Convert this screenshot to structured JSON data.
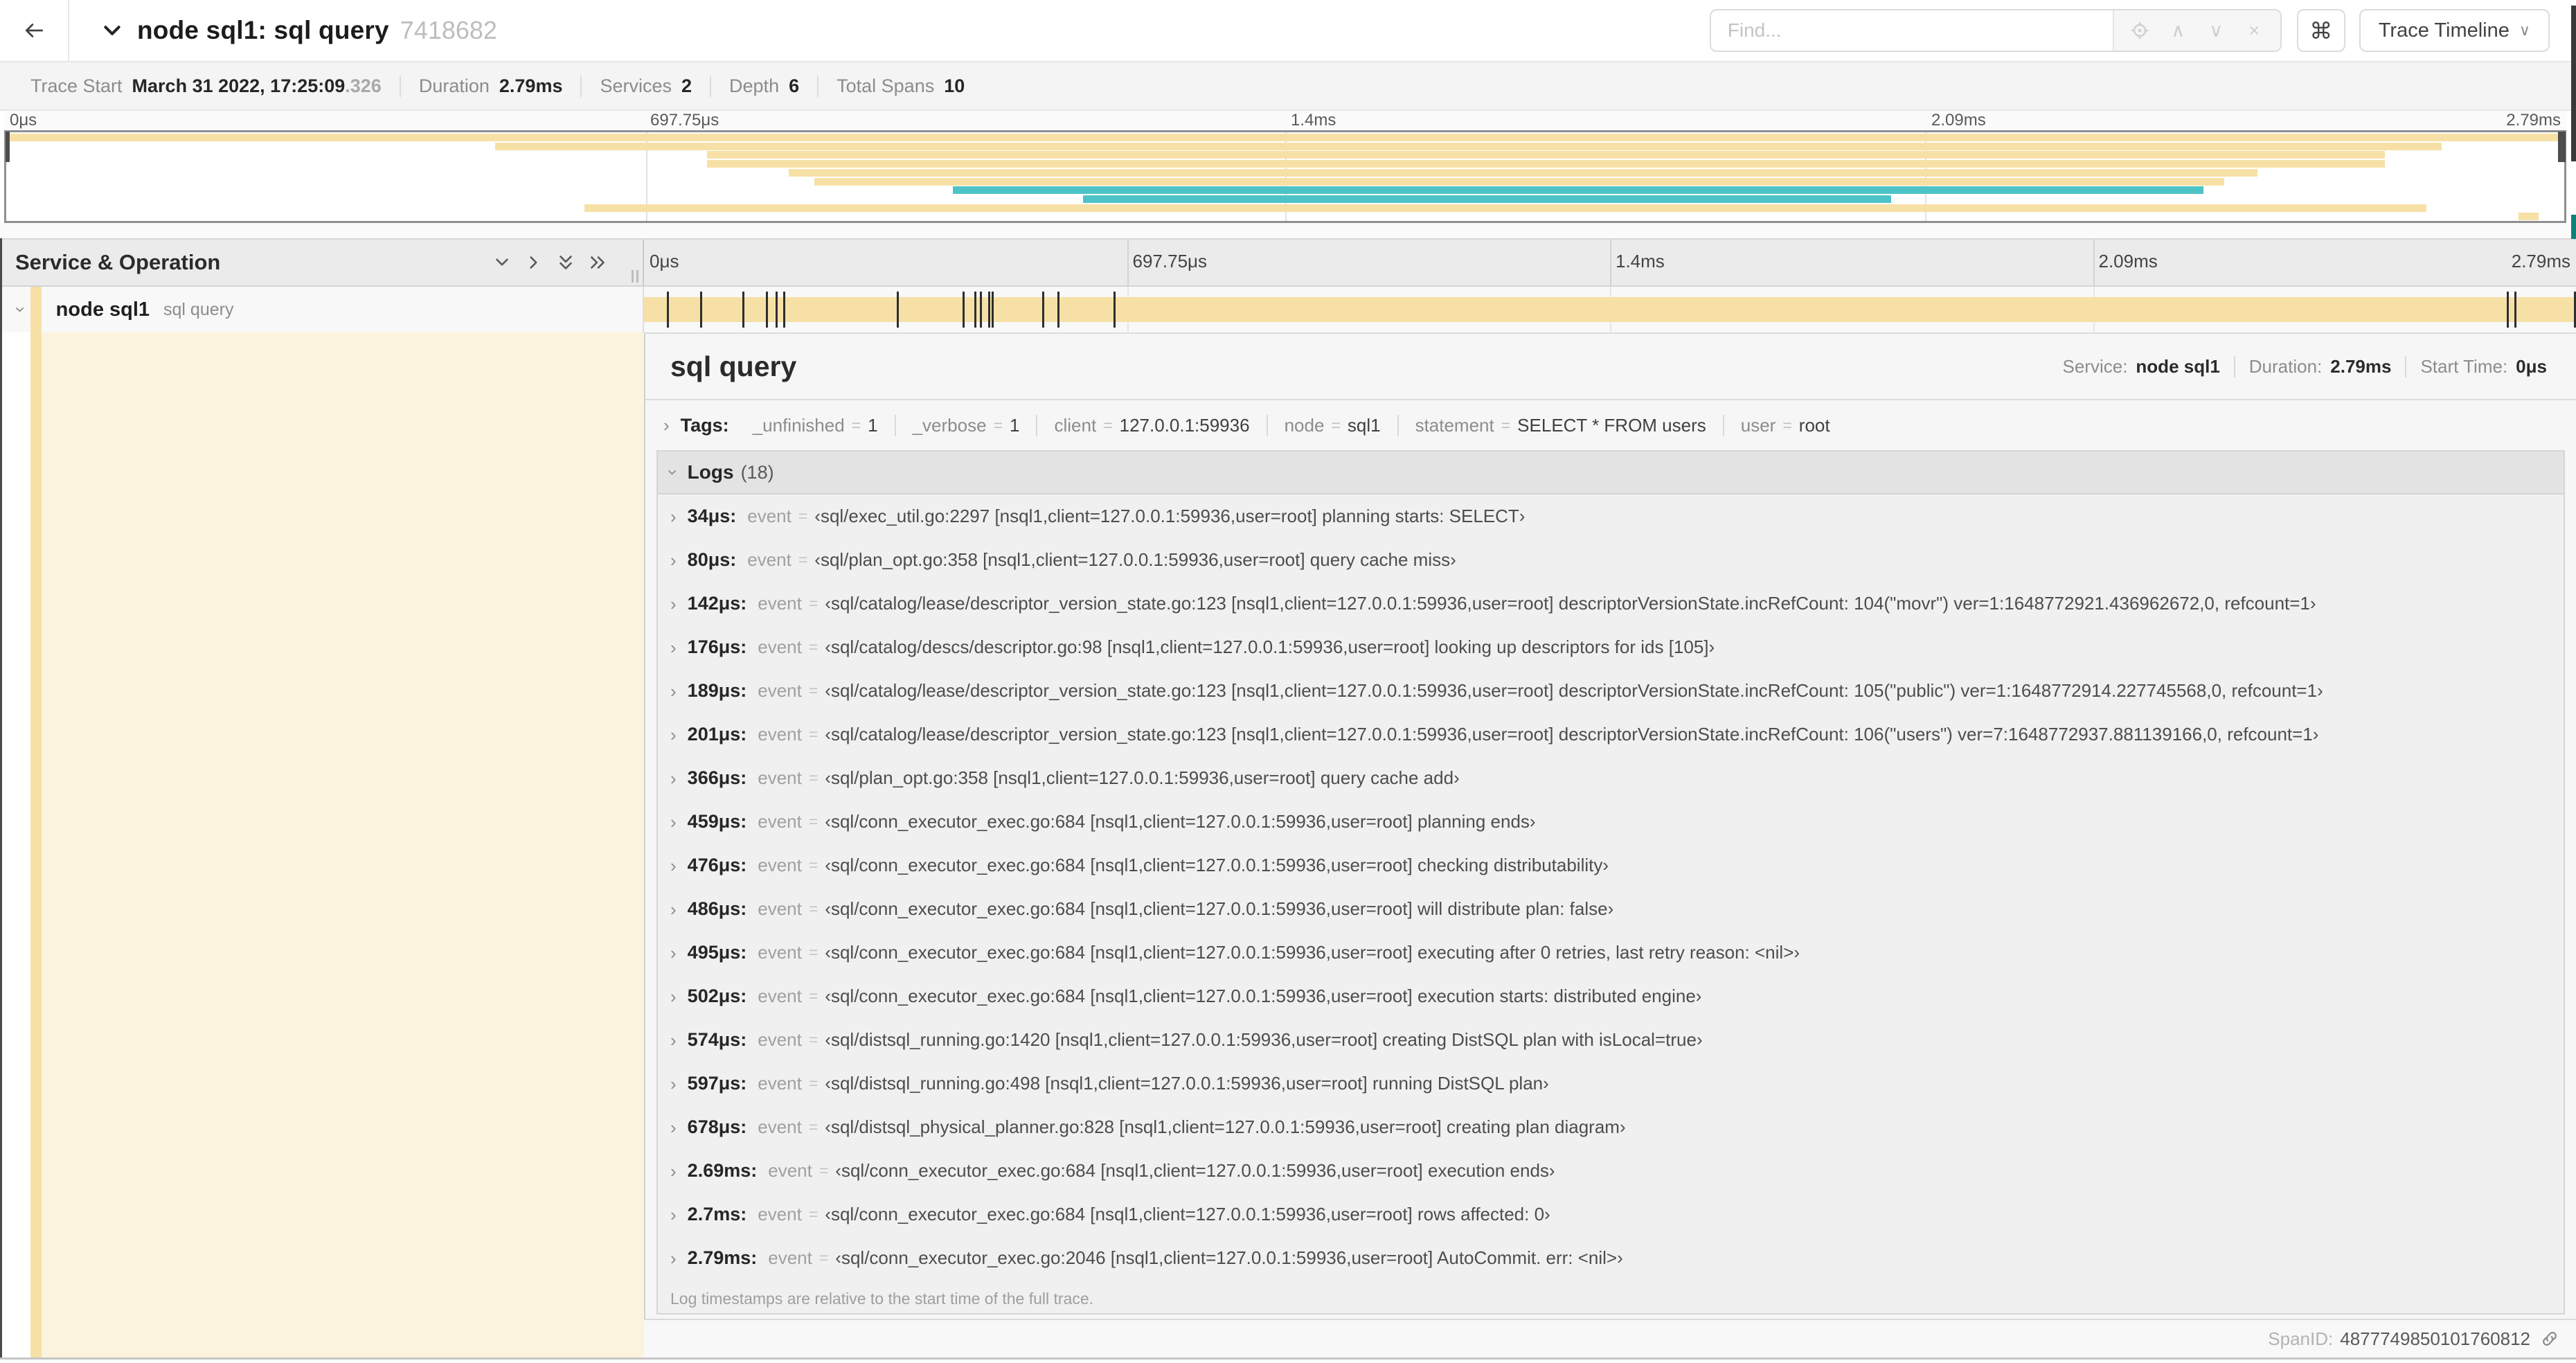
{
  "colors": {
    "yellow": "#F6E0A5",
    "teal": "#4EC3C7",
    "cream": "#FBF3DE",
    "scrubber": "#4D4D4D",
    "marker": "#2E2E2E"
  },
  "header": {
    "title": "node sql1: sql query",
    "trace_id_short": "7418682",
    "find_placeholder": "Find...",
    "prev_icon": "∧",
    "next_icon": "∨",
    "clear_icon": "×",
    "shortcut_icon": "⌘",
    "view_dropdown_label": "Trace Timeline",
    "view_dropdown_chevron": "∨"
  },
  "trace_info": {
    "items": [
      {
        "label": "Trace Start",
        "value": "March 31 2022, 17:25:09",
        "suffix": ".326"
      },
      {
        "label": "Duration",
        "value": "2.79ms"
      },
      {
        "label": "Services",
        "value": "2"
      },
      {
        "label": "Depth",
        "value": "6"
      },
      {
        "label": "Total Spans",
        "value": "10"
      }
    ]
  },
  "ruler": {
    "ticks": [
      {
        "label": "0μs",
        "pct": 0
      },
      {
        "label": "697.75μs",
        "pct": 25
      },
      {
        "label": "1.4ms",
        "pct": 50
      },
      {
        "label": "2.09ms",
        "pct": 75
      },
      {
        "label": "2.79ms",
        "pct": 100
      }
    ]
  },
  "minimap": {
    "rows": [
      {
        "start": 0,
        "end": 100,
        "color": "yellow"
      },
      {
        "start": 19.1,
        "end": 95.2,
        "color": "yellow"
      },
      {
        "start": 27.4,
        "end": 93.0,
        "color": "yellow"
      },
      {
        "start": 27.4,
        "end": 93.0,
        "color": "yellow"
      },
      {
        "start": 30.6,
        "end": 88.0,
        "color": "yellow"
      },
      {
        "start": 31.6,
        "end": 86.7,
        "color": "yellow"
      },
      {
        "start": 37.0,
        "end": 85.9,
        "color": "teal"
      },
      {
        "start": 42.1,
        "end": 73.7,
        "color": "teal"
      },
      {
        "start": 22.6,
        "end": 94.6,
        "color": "yellow"
      },
      {
        "start": 98.2,
        "end": 99.0,
        "color": "yellow"
      }
    ]
  },
  "timeline": {
    "left_header": "Service & Operation",
    "span_row": {
      "service": "node sql1",
      "operation": "sql query",
      "bar": {
        "start": 0,
        "end": 100,
        "color": "yellow"
      }
    },
    "log_marker_pcts": [
      1.2,
      2.9,
      5.1,
      6.3,
      6.8,
      7.2,
      13.1,
      16.5,
      17.1,
      17.4,
      17.8,
      18.0,
      20.6,
      21.4,
      24.3,
      96.4,
      96.8,
      99.9
    ]
  },
  "detail": {
    "operation": "sql query",
    "meta": [
      {
        "label": "Service:",
        "value": "node sql1"
      },
      {
        "label": "Duration:",
        "value": "2.79ms"
      },
      {
        "label": "Start Time:",
        "value": "0μs"
      }
    ],
    "tags_label": "Tags:",
    "tags_eq": "=",
    "tags": [
      {
        "key": "_unfinished",
        "value": "1"
      },
      {
        "key": "_verbose",
        "value": "1"
      },
      {
        "key": "client",
        "value": "127.0.0.1:59936"
      },
      {
        "key": "node",
        "value": "sql1"
      },
      {
        "key": "statement",
        "value": "SELECT * FROM users"
      },
      {
        "key": "user",
        "value": "root"
      }
    ],
    "logs_label": "Logs",
    "logs_count": "(18)",
    "log_field_label": "event",
    "log_eq": "=",
    "logs": [
      {
        "time": "34μs:",
        "value": "‹sql/exec_util.go:2297 [nsql1,client=127.0.0.1:59936,user=root] planning starts: SELECT›"
      },
      {
        "time": "80μs:",
        "value": "‹sql/plan_opt.go:358 [nsql1,client=127.0.0.1:59936,user=root] query cache miss›"
      },
      {
        "time": "142μs:",
        "value": "‹sql/catalog/lease/descriptor_version_state.go:123 [nsql1,client=127.0.0.1:59936,user=root] descriptorVersionState.incRefCount: 104(\"movr\") ver=1:1648772921.436962672,0, refcount=1›"
      },
      {
        "time": "176μs:",
        "value": "‹sql/catalog/descs/descriptor.go:98 [nsql1,client=127.0.0.1:59936,user=root] looking up descriptors for ids [105]›"
      },
      {
        "time": "189μs:",
        "value": "‹sql/catalog/lease/descriptor_version_state.go:123 [nsql1,client=127.0.0.1:59936,user=root] descriptorVersionState.incRefCount: 105(\"public\") ver=1:1648772914.227745568,0, refcount=1›"
      },
      {
        "time": "201μs:",
        "value": "‹sql/catalog/lease/descriptor_version_state.go:123 [nsql1,client=127.0.0.1:59936,user=root] descriptorVersionState.incRefCount: 106(\"users\") ver=7:1648772937.881139166,0, refcount=1›"
      },
      {
        "time": "366μs:",
        "value": "‹sql/plan_opt.go:358 [nsql1,client=127.0.0.1:59936,user=root] query cache add›"
      },
      {
        "time": "459μs:",
        "value": "‹sql/conn_executor_exec.go:684 [nsql1,client=127.0.0.1:59936,user=root] planning ends›"
      },
      {
        "time": "476μs:",
        "value": "‹sql/conn_executor_exec.go:684 [nsql1,client=127.0.0.1:59936,user=root] checking distributability›"
      },
      {
        "time": "486μs:",
        "value": "‹sql/conn_executor_exec.go:684 [nsql1,client=127.0.0.1:59936,user=root] will distribute plan: false›"
      },
      {
        "time": "495μs:",
        "value": "‹sql/conn_executor_exec.go:684 [nsql1,client=127.0.0.1:59936,user=root] executing after 0 retries, last retry reason: <nil>›"
      },
      {
        "time": "502μs:",
        "value": "‹sql/conn_executor_exec.go:684 [nsql1,client=127.0.0.1:59936,user=root] execution starts: distributed engine›"
      },
      {
        "time": "574μs:",
        "value": "‹sql/distsql_running.go:1420 [nsql1,client=127.0.0.1:59936,user=root] creating DistSQL plan with isLocal=true›"
      },
      {
        "time": "597μs:",
        "value": "‹sql/distsql_running.go:498 [nsql1,client=127.0.0.1:59936,user=root] running DistSQL plan›"
      },
      {
        "time": "678μs:",
        "value": "‹sql/distsql_physical_planner.go:828 [nsql1,client=127.0.0.1:59936,user=root] creating plan diagram›"
      },
      {
        "time": "2.69ms:",
        "value": "‹sql/conn_executor_exec.go:684 [nsql1,client=127.0.0.1:59936,user=root] execution ends›"
      },
      {
        "time": "2.7ms:",
        "value": "‹sql/conn_executor_exec.go:684 [nsql1,client=127.0.0.1:59936,user=root] rows affected: 0›"
      },
      {
        "time": "2.79ms:",
        "value": "‹sql/conn_executor_exec.go:2046 [nsql1,client=127.0.0.1:59936,user=root] AutoCommit. err: <nil>›"
      }
    ],
    "note": "Log timestamps are relative to the start time of the full trace.",
    "span_id_label": "SpanID:",
    "span_id": "4877749850101760812"
  }
}
